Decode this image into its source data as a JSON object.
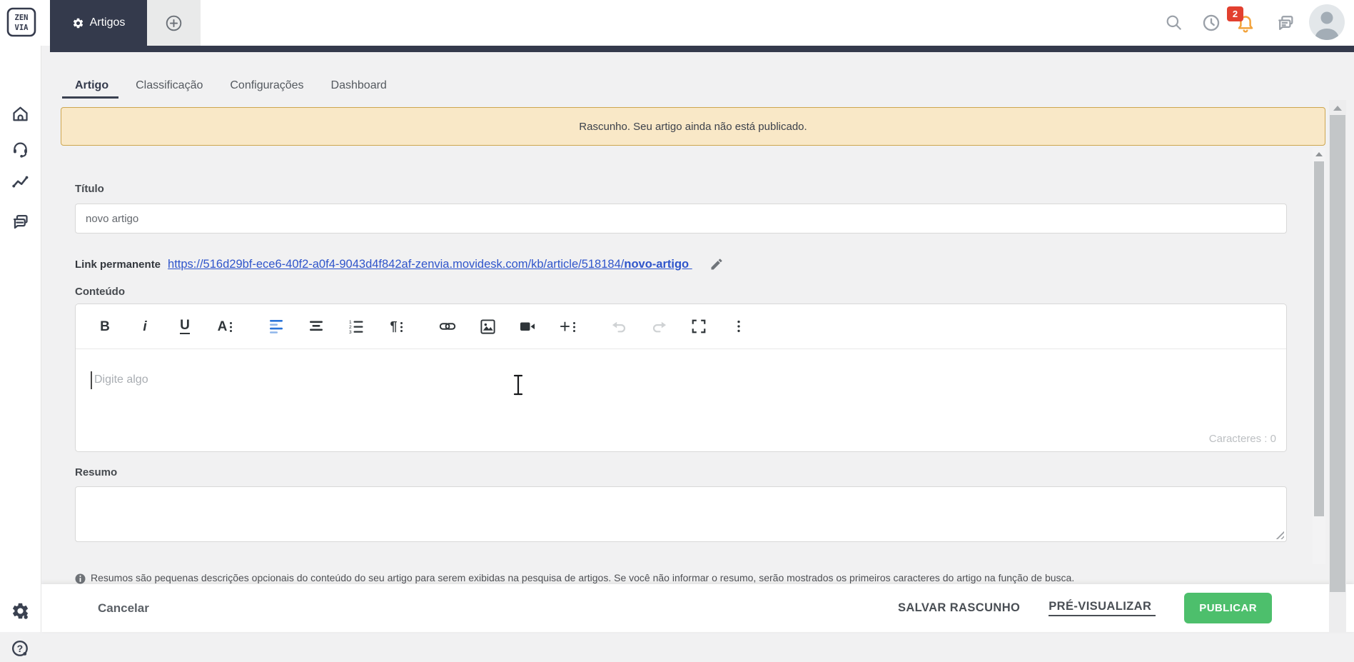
{
  "topbar": {
    "app_tab": "Artigos",
    "notification_count": "2"
  },
  "logo": {
    "line1": "ZEN",
    "line2": "VIA"
  },
  "tabs": [
    {
      "label": "Artigo",
      "active": true
    },
    {
      "label": "Classificação",
      "active": false
    },
    {
      "label": "Configurações",
      "active": false
    },
    {
      "label": "Dashboard",
      "active": false
    }
  ],
  "banner": {
    "text": "Rascunho. Seu artigo ainda não está publicado."
  },
  "form": {
    "title_label": "Título",
    "title_value": "novo artigo",
    "permalink_label": "Link permanente",
    "permalink_url": "https://516d29bf-ece6-40f2-a0f4-9043d4f842af-zenvia.movidesk.com/kb/article/518184/",
    "permalink_slug": "novo-artigo",
    "content_label": "Conteúdo",
    "editor_placeholder": "Digite algo",
    "char_count": "Caracteres : 0",
    "summary_label": "Resumo",
    "summary_help": "Resumos são pequenas descrições opcionais do conteúdo do seu artigo para serem exibidas na pesquisa de artigos. Se você não informar o resumo, serão mostrados os primeiros caracteres do artigo na função de busca."
  },
  "toolbar": {
    "bold": "B",
    "italic": "i",
    "underline": "U",
    "more_text": "A",
    "paragraph": "¶",
    "plus": "+"
  },
  "footer": {
    "cancel": "Cancelar",
    "save_draft": "SALVAR RASCUNHO",
    "preview": "PRÉ-VISUALIZAR",
    "publish": "PUBLICAR"
  },
  "colors": {
    "navy": "#343a4c",
    "banner_bg": "#f9e8c7",
    "banner_border": "#cda64f",
    "link_blue": "#2f55cb",
    "accent_green": "#4dbf6c",
    "bell_orange": "#f2a33c",
    "badge_red": "#e2402f",
    "toolbar_active_blue": "#2a74d8"
  }
}
